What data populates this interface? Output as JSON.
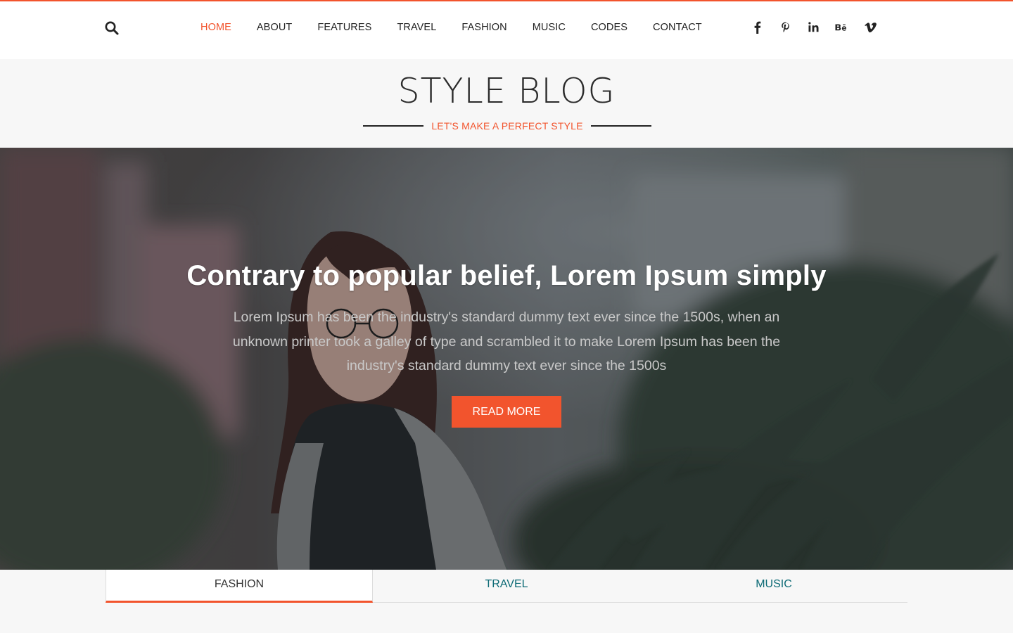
{
  "nav": {
    "items": [
      {
        "label": "HOME",
        "active": true
      },
      {
        "label": "ABOUT",
        "active": false
      },
      {
        "label": "FEATURES",
        "active": false
      },
      {
        "label": "TRAVEL",
        "active": false
      },
      {
        "label": "FASHION",
        "active": false
      },
      {
        "label": "MUSIC",
        "active": false
      },
      {
        "label": "CODES",
        "active": false
      },
      {
        "label": "CONTACT",
        "active": false
      }
    ],
    "search_icon": "search-icon",
    "social_icons": [
      "facebook-icon",
      "pinterest-icon",
      "linkedin-icon",
      "behance-icon",
      "vimeo-icon"
    ]
  },
  "brand": {
    "title": "STYLE BLOG",
    "tagline": "LET'S MAKE A PERFECT STYLE"
  },
  "hero": {
    "title": "Contrary to popular belief, Lorem Ipsum simply",
    "text": "Lorem Ipsum has been the industry's standard dummy text ever since the 1500s, when an unknown printer took a galley of type and scrambled it to make Lorem Ipsum has been the industry's standard dummy text ever since the 1500s",
    "button_label": "READ MORE"
  },
  "tabs": [
    {
      "label": "FASHION",
      "active": true
    },
    {
      "label": "TRAVEL",
      "active": false
    },
    {
      "label": "MUSIC",
      "active": false
    }
  ],
  "colors": {
    "accent": "#f2542d",
    "tab_link": "#0c6a75",
    "text_dark": "#222222",
    "background": "#f7f7f7"
  }
}
